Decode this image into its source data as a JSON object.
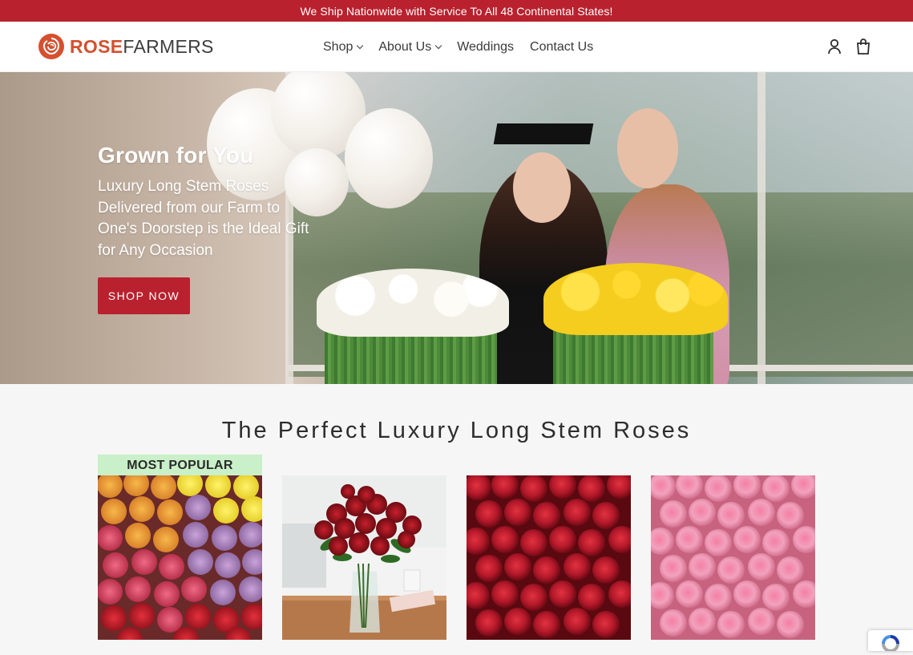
{
  "announcement": "We Ship Nationwide with Service To All 48 Continental States!",
  "logo": {
    "rose": "ROSE",
    "farmers": "FARMERS"
  },
  "nav": [
    {
      "label": "Shop",
      "dropdown": true
    },
    {
      "label": "About Us",
      "dropdown": true
    },
    {
      "label": "Weddings",
      "dropdown": false
    },
    {
      "label": "Contact Us",
      "dropdown": false
    }
  ],
  "header_icons": [
    "user-icon",
    "cart-icon"
  ],
  "hero": {
    "title": "Grown for You",
    "subtitle": "Luxury Long Stem Roses Delivered from our Farm to One's Doorstep is the Ideal Gift for Any Occasion",
    "cta": "SHOP NOW"
  },
  "section": {
    "title": "The Perfect Luxury Long Stem Roses",
    "badge": "MOST POPULAR",
    "products": [
      {
        "image": "mixed-roses"
      },
      {
        "image": "red-roses-vase"
      },
      {
        "image": "red-roses"
      },
      {
        "image": "pink-roses"
      }
    ]
  },
  "colors": {
    "brand_red": "#b9212e",
    "logo_orange": "#d4502f",
    "badge_green": "#c9f0c9"
  }
}
